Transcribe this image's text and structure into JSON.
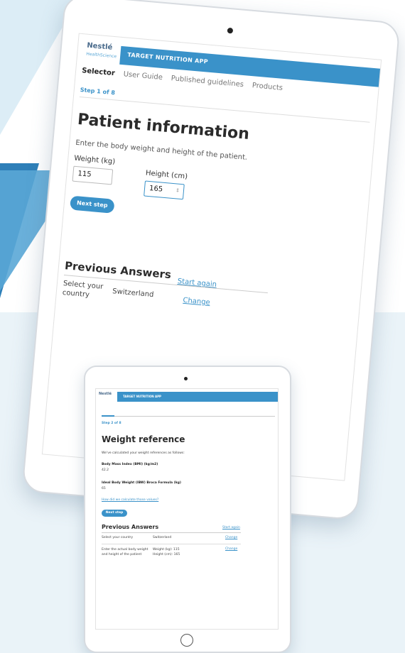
{
  "app": {
    "brand_name": "Nestlé",
    "brand_sub": "HealthScience",
    "title": "TARGET NUTRITION APP"
  },
  "tabs": [
    {
      "label": "Selector"
    },
    {
      "label": "User Guide"
    },
    {
      "label": "Published guidelines"
    },
    {
      "label": "Products"
    }
  ],
  "large_screen": {
    "step": "Step 1 of 8",
    "title": "Patient information",
    "description": "Enter the body weight and height of the patient.",
    "weight_label": "Weight (kg)",
    "weight_value": "115",
    "height_label": "Height (cm)",
    "height_value": "165",
    "next_button": "Next step",
    "previous_title": "Previous Answers",
    "start_again": "Start again",
    "answers": [
      {
        "question": "Select your country",
        "answer": "Switzerland",
        "change": "Change"
      }
    ]
  },
  "small_screen": {
    "step": "Step 2 of 8",
    "title": "Weight reference",
    "intro": "We've calculated your weight references as follows:",
    "bmi_label": "Body Mass Index (BMI) (kg/m2)",
    "bmi_value": "42.2",
    "ibw_label": "Ideal Body Weight (IBW) Broca Formula (kg)",
    "ibw_value": "65",
    "calc_link": "How did we calculate those values?",
    "next_button": "Next step",
    "previous_title": "Previous Answers",
    "start_again": "Start again",
    "answers": [
      {
        "question": "Select your country",
        "answer": "Switzerland",
        "change": "Change"
      },
      {
        "question": "Enter the actual body weight and height of the patient",
        "answer": "Weight (kg): 115\nHeight (cm): 165",
        "change": "Change"
      }
    ]
  },
  "colors": {
    "accent": "#3a92c9",
    "background": "#eaf3f8"
  }
}
